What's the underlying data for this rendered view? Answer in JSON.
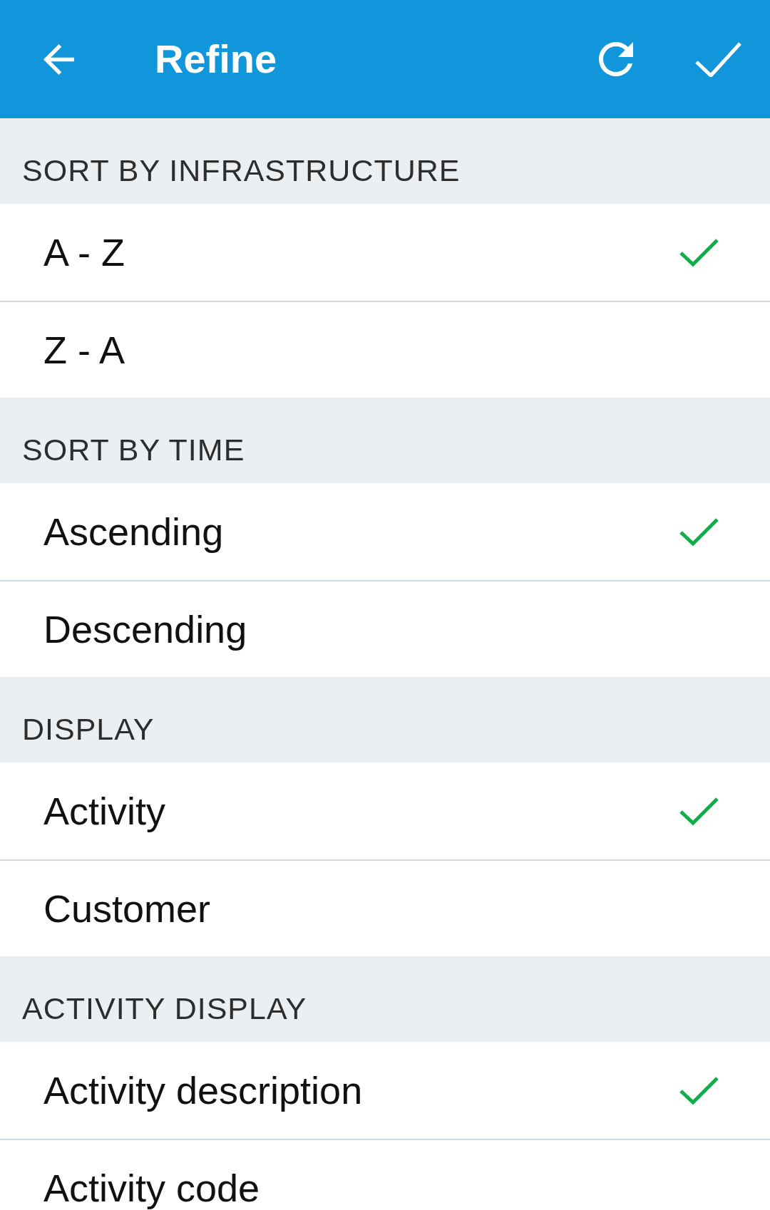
{
  "app_bar": {
    "title": "Refine"
  },
  "sections": [
    {
      "title": "SORT BY INFRASTRUCTURE",
      "options": [
        {
          "label": "A - Z",
          "selected": true
        },
        {
          "label": "Z - A",
          "selected": false
        }
      ]
    },
    {
      "title": "SORT BY TIME",
      "options": [
        {
          "label": "Ascending",
          "selected": true
        },
        {
          "label": "Descending",
          "selected": false
        }
      ]
    },
    {
      "title": "DISPLAY",
      "options": [
        {
          "label": "Activity",
          "selected": true
        },
        {
          "label": "Customer",
          "selected": false
        }
      ]
    },
    {
      "title": "ACTIVITY DISPLAY",
      "options": [
        {
          "label": "Activity description",
          "selected": true
        },
        {
          "label": "Activity code",
          "selected": false
        }
      ]
    }
  ]
}
